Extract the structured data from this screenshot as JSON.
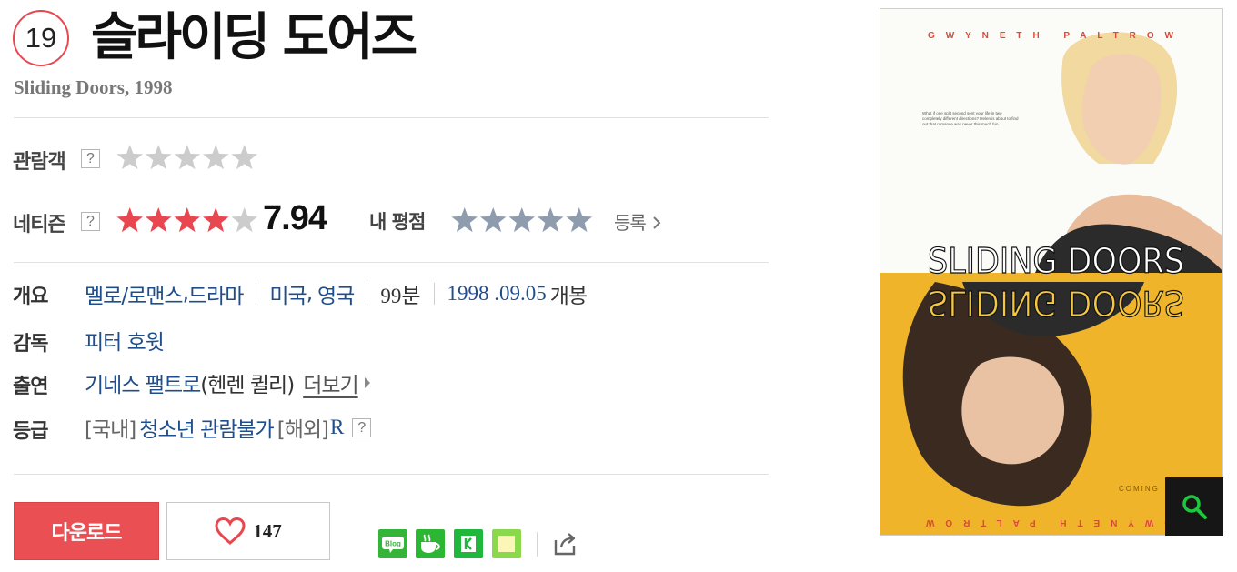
{
  "movie": {
    "age_rating": "19",
    "title": "슬라이딩 도어즈",
    "subtitle": "Sliding Doors, 1998"
  },
  "ratings": {
    "audience_label": "관람객",
    "audience_stars": 0,
    "netizen_label": "네티즌",
    "netizen_stars": 4,
    "netizen_score": "7.94",
    "my_rating_label": "내 평점",
    "my_rating_stars": 0,
    "register_label": "등록",
    "help_glyph": "?"
  },
  "info": {
    "overview_label": "개요",
    "genre_1": "멜로/로맨스",
    "genre_sep": ",",
    "genre_2": "드라마",
    "country_1": "미국",
    "country_sep": ",",
    "country_2": "영국",
    "runtime": "99분",
    "release_date": "1998 .09.05",
    "release_suffix": "개봉",
    "director_label": "감독",
    "director": "피터 호윗",
    "cast_label": "출연",
    "cast_name": "기네스 팰트로",
    "cast_role": "(헨렌 퀼리)",
    "cast_more": "더보기",
    "grade_label": "등급",
    "grade_domestic_prefix": "[국내]",
    "grade_domestic": "청소년 관람불가",
    "grade_overseas_prefix": "[해외]",
    "grade_overseas": "R"
  },
  "actions": {
    "download_label": "다운로드",
    "like_count": "147",
    "share_icons": [
      "blog-share-icon",
      "cafe-share-icon",
      "kakao-share-icon",
      "memo-share-icon",
      "external-share-icon"
    ],
    "blog_icon_text": "Blog"
  },
  "poster": {
    "top_credit": "GWYNETH PALTROW",
    "tagline": "What if one split second sent your life in two completely different directions? Helen is about to find out that romance was never this much fun.",
    "title_art": "SLIDING DOORS",
    "coming": "COMING",
    "bottom_credit": "GWYNETH PALTROW"
  },
  "colors": {
    "accent_red": "#ea4f54",
    "star_red": "#e9474f",
    "star_grey": "#cccccc",
    "star_blue_grey": "#8e9cad",
    "link_blue": "#1f4e8c",
    "poster_yellow": "#efb42a"
  }
}
